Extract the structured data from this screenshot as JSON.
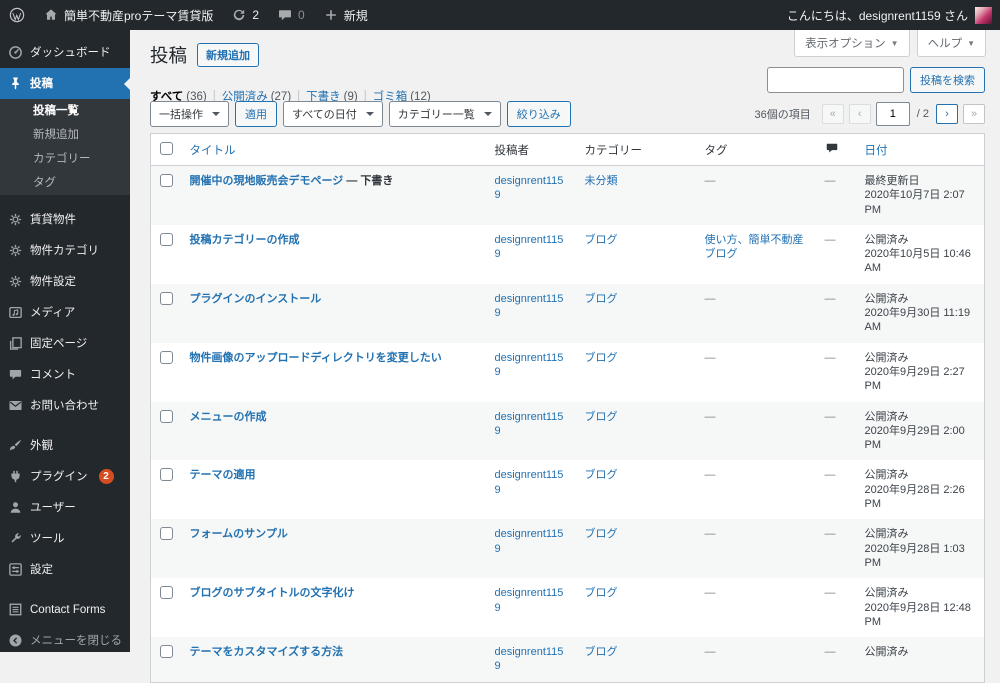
{
  "colors": {
    "accent": "#2271b1",
    "sidebar_bg": "#23282d",
    "badge": "#d54e21",
    "row_stripe": "#f6f7f7",
    "border": "#ccd0d4"
  },
  "admin_bar": {
    "site_name": "簡単不動産proテーマ賃貸版",
    "updates_count": "2",
    "comments_count": "0",
    "new_label": "新規",
    "greeting": "こんにちは、designrent1159 さん"
  },
  "sidebar": {
    "items": [
      {
        "name": "dashboard",
        "label": "ダッシュボード",
        "icon": "dashboard-icon",
        "type": "top"
      },
      {
        "name": "posts",
        "label": "投稿",
        "icon": "pin-icon",
        "type": "top",
        "active": true
      },
      {
        "name": "posts-all",
        "label": "投稿一覧",
        "type": "sub",
        "current": true
      },
      {
        "name": "posts-new",
        "label": "新規追加",
        "type": "sub"
      },
      {
        "name": "categories",
        "label": "カテゴリー",
        "type": "sub"
      },
      {
        "name": "tags",
        "label": "タグ",
        "type": "sub"
      },
      {
        "name": "rental-properties",
        "label": "賃貸物件",
        "icon": "gear-icon",
        "type": "top",
        "gap_before": true
      },
      {
        "name": "property-categories",
        "label": "物件カテゴリ",
        "icon": "gear-icon",
        "type": "top"
      },
      {
        "name": "property-settings",
        "label": "物件設定",
        "icon": "gear-icon",
        "type": "top"
      },
      {
        "name": "media",
        "label": "メディア",
        "icon": "media-icon",
        "type": "top"
      },
      {
        "name": "pages",
        "label": "固定ページ",
        "icon": "pages-icon",
        "type": "top"
      },
      {
        "name": "comments",
        "label": "コメント",
        "icon": "comment-icon",
        "type": "top"
      },
      {
        "name": "contact",
        "label": "お問い合わせ",
        "icon": "mail-icon",
        "type": "top"
      },
      {
        "name": "appearance",
        "label": "外観",
        "icon": "brush-icon",
        "type": "top",
        "gap_before": true
      },
      {
        "name": "plugins",
        "label": "プラグイン",
        "icon": "plugin-icon",
        "type": "top",
        "badge": "2"
      },
      {
        "name": "users",
        "label": "ユーザー",
        "icon": "user-icon",
        "type": "top"
      },
      {
        "name": "tools",
        "label": "ツール",
        "icon": "wrench-icon",
        "type": "top"
      },
      {
        "name": "settings",
        "label": "設定",
        "icon": "settings-icon",
        "type": "top"
      },
      {
        "name": "contact-forms",
        "label": "Contact Forms",
        "icon": "list-icon",
        "type": "top",
        "gap_before": true
      },
      {
        "name": "collapse-menu",
        "label": "メニューを閉じる",
        "icon": "collapse-icon",
        "type": "top",
        "muted": true
      }
    ]
  },
  "header": {
    "title": "投稿",
    "add_new": "新規追加",
    "screen_options": "表示オプション",
    "help": "ヘルプ"
  },
  "views": [
    {
      "name": "all",
      "label": "すべて",
      "count": "(36)",
      "current": true
    },
    {
      "name": "published",
      "label": "公開済み",
      "count": "(27)"
    },
    {
      "name": "draft",
      "label": "下書き",
      "count": "(9)"
    },
    {
      "name": "trash",
      "label": "ゴミ箱",
      "count": "(12)"
    }
  ],
  "search": {
    "value": "",
    "button": "投稿を検索"
  },
  "tablenav": {
    "bulk_action": "一括操作",
    "apply": "適用",
    "date_filter": "すべての日付",
    "category_filter": "カテゴリー一覧",
    "filter_button": "絞り込み",
    "items_count": "36個の項目",
    "first": "«",
    "prev": "‹",
    "current_page": "1",
    "total_pages": "/ 2",
    "next": "›",
    "last": "»"
  },
  "table": {
    "headers": {
      "title": "タイトル",
      "author": "投稿者",
      "category": "カテゴリー",
      "tags": "タグ",
      "comments_icon": "comment-icon",
      "date": "日付"
    },
    "rows": [
      {
        "title": "開催中の現地販売会デモページ",
        "suffix": " — 下書き",
        "author": "designrent1159",
        "category": "未分類",
        "tags": "—",
        "comments": "—",
        "date_status": "最終更新日",
        "date": "2020年10月7日 2:07 PM"
      },
      {
        "title": "投稿カテゴリーの作成",
        "suffix": "",
        "author": "designrent1159",
        "category": "ブログ",
        "tags": "使い方、簡単不動産ブログ",
        "comments": "—",
        "date_status": "公開済み",
        "date": "2020年10月5日 10:46 AM"
      },
      {
        "title": "プラグインのインストール",
        "suffix": "",
        "author": "designrent1159",
        "category": "ブログ",
        "tags": "—",
        "comments": "—",
        "date_status": "公開済み",
        "date": "2020年9月30日 11:19 AM"
      },
      {
        "title": "物件画像のアップロードディレクトリを変更したい",
        "suffix": "",
        "author": "designrent1159",
        "category": "ブログ",
        "tags": "—",
        "comments": "—",
        "date_status": "公開済み",
        "date": "2020年9月29日 2:27 PM"
      },
      {
        "title": "メニューの作成",
        "suffix": "",
        "author": "designrent1159",
        "category": "ブログ",
        "tags": "—",
        "comments": "—",
        "date_status": "公開済み",
        "date": "2020年9月29日 2:00 PM"
      },
      {
        "title": "テーマの適用",
        "suffix": "",
        "author": "designrent1159",
        "category": "ブログ",
        "tags": "—",
        "comments": "—",
        "date_status": "公開済み",
        "date": "2020年9月28日 2:26 PM"
      },
      {
        "title": "フォームのサンプル",
        "suffix": "",
        "author": "designrent1159",
        "category": "ブログ",
        "tags": "—",
        "comments": "—",
        "date_status": "公開済み",
        "date": "2020年9月28日 1:03 PM"
      },
      {
        "title": "ブログのサブタイトルの文字化け",
        "suffix": "",
        "author": "designrent1159",
        "category": "ブログ",
        "tags": "—",
        "comments": "—",
        "date_status": "公開済み",
        "date": "2020年9月28日 12:48 PM"
      },
      {
        "title": "テーマをカスタマイズする方法",
        "suffix": "",
        "author": "designrent1159",
        "category": "ブログ",
        "tags": "—",
        "comments": "—",
        "date_status": "公開済み",
        "date": ""
      }
    ]
  }
}
